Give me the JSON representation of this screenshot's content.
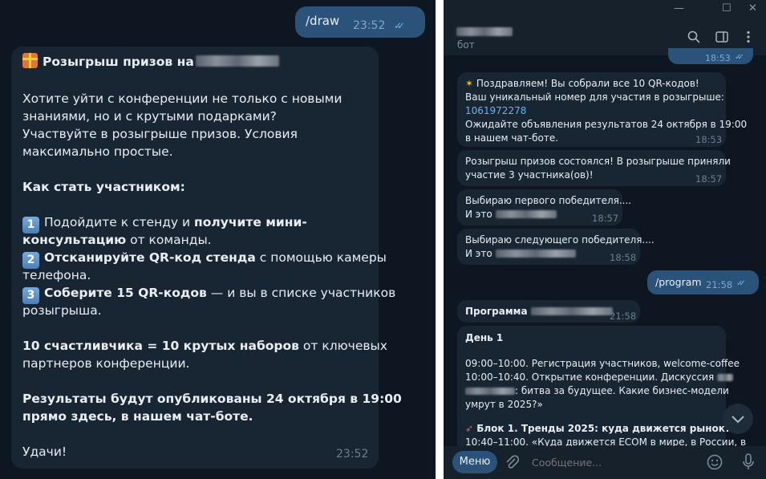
{
  "left": {
    "draw_msg": {
      "text": "/draw",
      "time": "23:52"
    },
    "prize": {
      "title": "Розыгрыш призов на",
      "intro1": "Хотите уйти с конференции не только с новыми",
      "intro2": "знаниями, но и с крутыми подарками?",
      "intro3": "Участвуйте в розыгрыше призов. Условия",
      "intro4": "максимально простые.",
      "how_title": "Как стать участником:",
      "step1_num": "1",
      "step1_a": "Подойдите к стенду и ",
      "step1_b": "получите мини-",
      "step1_c": "консультацию",
      "step1_d": " от команды.",
      "step2_num": "2",
      "step2_a": "Отсканируйте QR-код стенда",
      "step2_b": " с помощью камеры",
      "step2_c": "телефона.",
      "step3_num": "3",
      "step3_a": "Соберите 15 QR-кодов",
      "step3_b": " — и вы в списке участников",
      "step3_c": "розыгрыша.",
      "lucky_a": "10 счастливчика = 10 крутых наборов",
      "lucky_b": " от ключевых",
      "lucky_c": "партнеров конференции.",
      "results1": "Результаты будут опубликованы 24 октября в 19:00",
      "results2": "прямо здесь, в нашем чат-боте.",
      "luck": "Удачи!",
      "time": "23:52"
    }
  },
  "right": {
    "header": {
      "subtitle": "бот"
    },
    "top_time": "18:53",
    "msg1": {
      "l1": "Поздравляем! Вы собрали все 10 QR-кодов!",
      "l2": "Ваш уникальный номер для участия в розыгрыше:",
      "number": "1061972278",
      "l4": "Ожидайте объявления результатов 24 октября в 19:00",
      "l5": "в нашем чат-боте.",
      "time": "18:53"
    },
    "msg2": {
      "l1": "Розыгрыш призов состоялся! В розыгрыше приняли",
      "l2": "участие 3 участника(ов)!",
      "time": "18:57"
    },
    "msg3": {
      "l1": "Выбираю первого победителя....",
      "l2": "И это",
      "time": "18:57"
    },
    "msg4": {
      "l1": "Выбираю следующего победителя....",
      "l2": "И это",
      "time": "18:58"
    },
    "program_cmd": {
      "text": "/program",
      "time": "21:58"
    },
    "program_title": {
      "text": "Программа",
      "time": "21:58"
    },
    "schedule": {
      "day": "День 1",
      "l1": "09:00–10:00. Регистрация участников, welcome-coffee",
      "l2": "10:00–10:40. Открытие конференции. Дискуссия",
      "l3": ": битва за будущее. Какие бизнес-модели",
      "l4": "умрут в 2025?»",
      "block": "Блок 1. Тренды 2025: куда движется рынок?",
      "l6": "10:40–11:00. «Куда движется ECOM в мире, в России, в"
    },
    "composer": {
      "menu_label": "Меню",
      "placeholder": "Сообщение..."
    }
  }
}
